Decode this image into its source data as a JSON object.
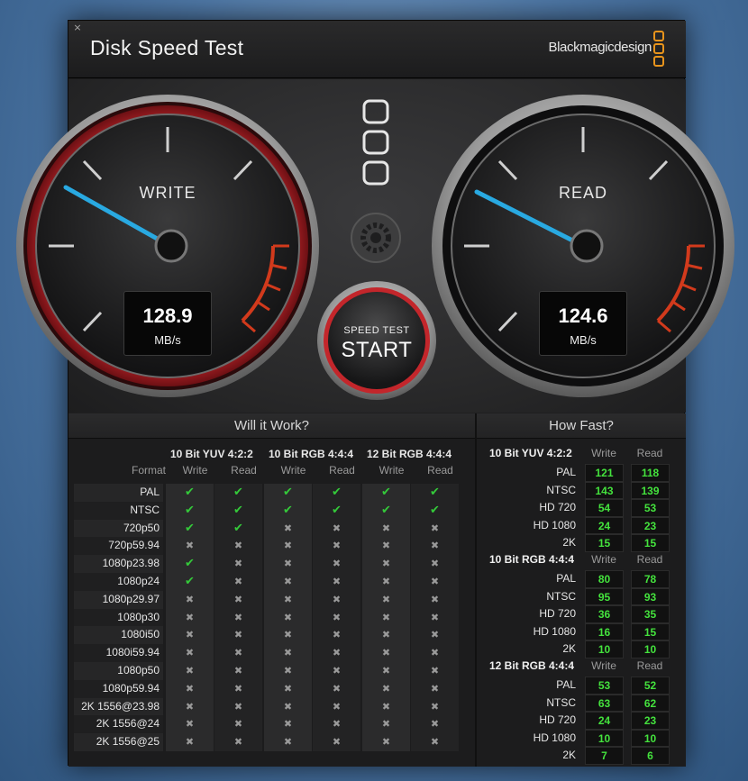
{
  "window": {
    "title": "Disk Speed Test",
    "brand": "Blackmagicdesign",
    "close_glyph": "×"
  },
  "colors": {
    "needle": "#29a9e1",
    "green": "#44e23d",
    "red_ring": "#b82026",
    "brand_orange": "#e8941c"
  },
  "gauges": {
    "write": {
      "label": "WRITE",
      "value": "128.9",
      "unit": "MB/s"
    },
    "read": {
      "label": "READ",
      "value": "124.6",
      "unit": "MB/s"
    }
  },
  "controls": {
    "speed_test_label": "SPEED TEST",
    "start_label": "START",
    "settings_icon": "gear-icon",
    "indicator_icon": "three-box-indicator-icon"
  },
  "will_it_work": {
    "title": "Will it Work?",
    "format_label": "Format",
    "groups": [
      "10 Bit YUV 4:2:2",
      "10 Bit RGB 4:4:4",
      "12 Bit RGB 4:4:4"
    ],
    "sub": [
      "Write",
      "Read"
    ],
    "rows": [
      {
        "format": "PAL",
        "cells": [
          true,
          true,
          true,
          true,
          true,
          true
        ]
      },
      {
        "format": "NTSC",
        "cells": [
          true,
          true,
          true,
          true,
          true,
          true
        ]
      },
      {
        "format": "720p50",
        "cells": [
          true,
          true,
          false,
          false,
          false,
          false
        ]
      },
      {
        "format": "720p59.94",
        "cells": [
          false,
          false,
          false,
          false,
          false,
          false
        ]
      },
      {
        "format": "1080p23.98",
        "cells": [
          true,
          false,
          false,
          false,
          false,
          false
        ]
      },
      {
        "format": "1080p24",
        "cells": [
          true,
          false,
          false,
          false,
          false,
          false
        ]
      },
      {
        "format": "1080p29.97",
        "cells": [
          false,
          false,
          false,
          false,
          false,
          false
        ]
      },
      {
        "format": "1080p30",
        "cells": [
          false,
          false,
          false,
          false,
          false,
          false
        ]
      },
      {
        "format": "1080i50",
        "cells": [
          false,
          false,
          false,
          false,
          false,
          false
        ]
      },
      {
        "format": "1080i59.94",
        "cells": [
          false,
          false,
          false,
          false,
          false,
          false
        ]
      },
      {
        "format": "1080p50",
        "cells": [
          false,
          false,
          false,
          false,
          false,
          false
        ]
      },
      {
        "format": "1080p59.94",
        "cells": [
          false,
          false,
          false,
          false,
          false,
          false
        ]
      },
      {
        "format": "2K 1556@23.98",
        "cells": [
          false,
          false,
          false,
          false,
          false,
          false
        ]
      },
      {
        "format": "2K 1556@24",
        "cells": [
          false,
          false,
          false,
          false,
          false,
          false
        ]
      },
      {
        "format": "2K 1556@25",
        "cells": [
          false,
          false,
          false,
          false,
          false,
          false
        ]
      }
    ]
  },
  "how_fast": {
    "title": "How Fast?",
    "sub": [
      "Write",
      "Read"
    ],
    "groups": [
      {
        "name": "10 Bit YUV 4:2:2",
        "rows": [
          {
            "label": "PAL",
            "write": "121",
            "read": "118"
          },
          {
            "label": "NTSC",
            "write": "143",
            "read": "139"
          },
          {
            "label": "HD 720",
            "write": "54",
            "read": "53"
          },
          {
            "label": "HD 1080",
            "write": "24",
            "read": "23"
          },
          {
            "label": "2K",
            "write": "15",
            "read": "15"
          }
        ]
      },
      {
        "name": "10 Bit RGB 4:4:4",
        "rows": [
          {
            "label": "PAL",
            "write": "80",
            "read": "78"
          },
          {
            "label": "NTSC",
            "write": "95",
            "read": "93"
          },
          {
            "label": "HD 720",
            "write": "36",
            "read": "35"
          },
          {
            "label": "HD 1080",
            "write": "16",
            "read": "15"
          },
          {
            "label": "2K",
            "write": "10",
            "read": "10"
          }
        ]
      },
      {
        "name": "12 Bit RGB 4:4:4",
        "rows": [
          {
            "label": "PAL",
            "write": "53",
            "read": "52"
          },
          {
            "label": "NTSC",
            "write": "63",
            "read": "62"
          },
          {
            "label": "HD 720",
            "write": "24",
            "read": "23"
          },
          {
            "label": "HD 1080",
            "write": "10",
            "read": "10"
          },
          {
            "label": "2K",
            "write": "7",
            "read": "6"
          }
        ]
      }
    ]
  }
}
